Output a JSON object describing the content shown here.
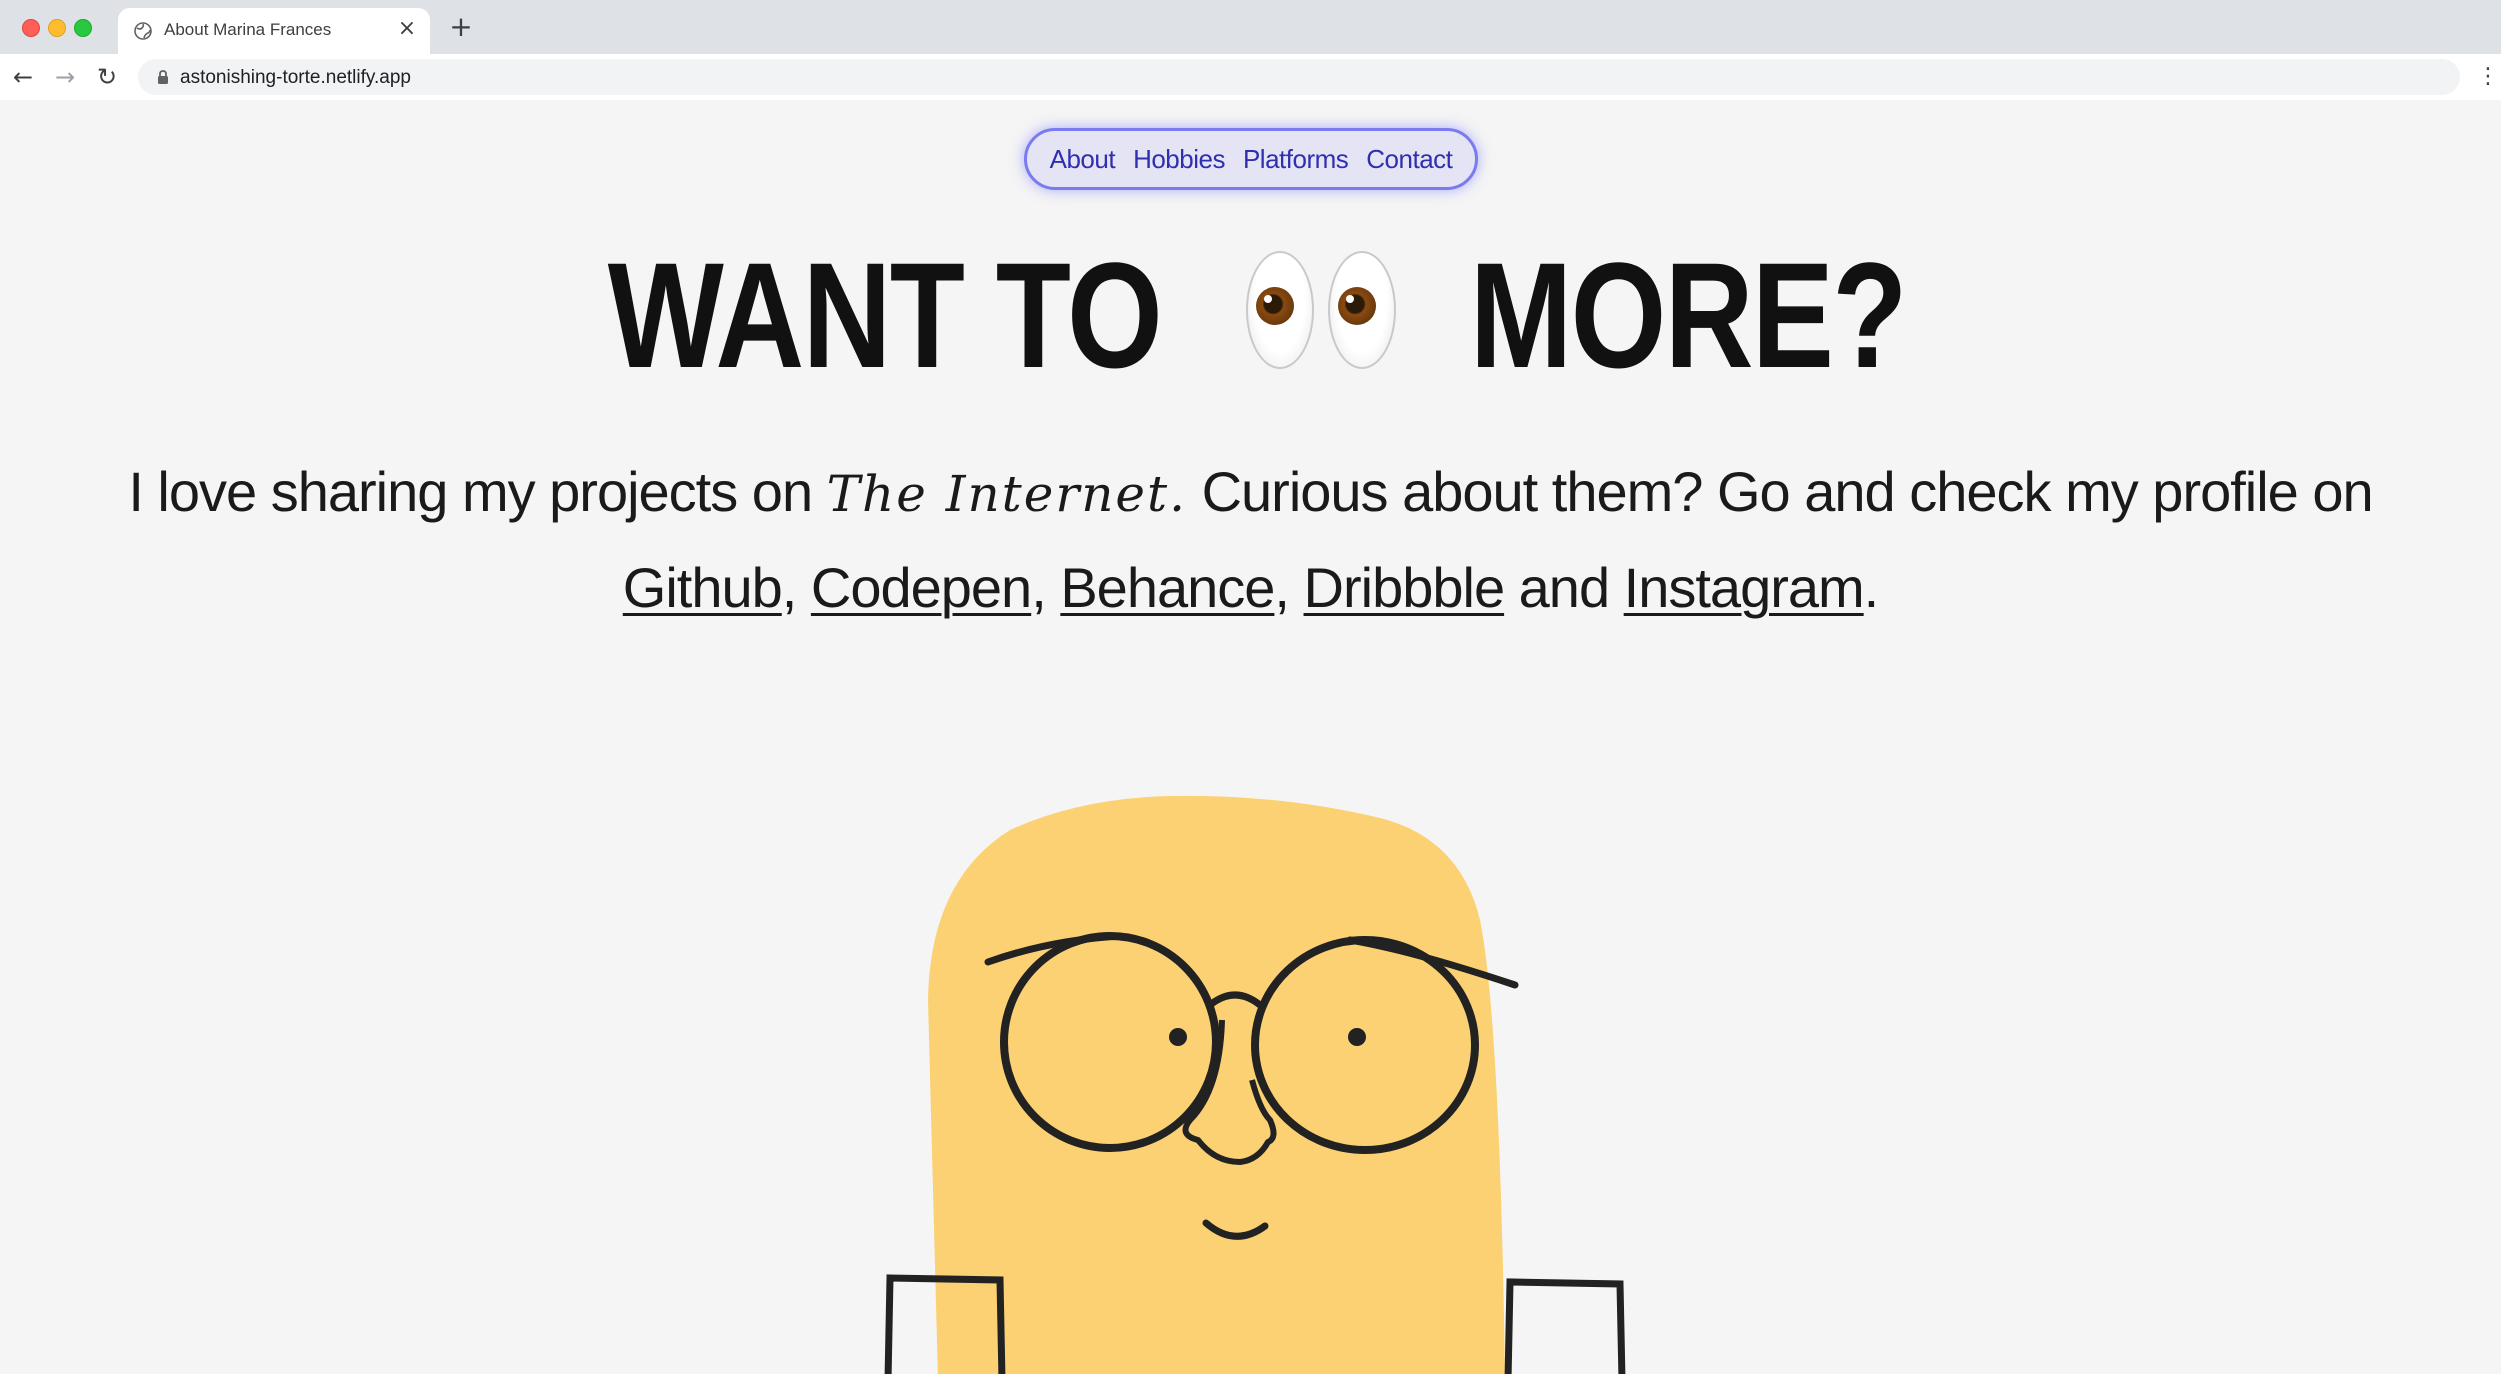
{
  "browser": {
    "tab_title": "About Marina Frances",
    "url": "astonishing-torte.netlify.app",
    "new_tab_symbol": "+",
    "close_symbol": "×"
  },
  "nav": {
    "items": [
      "About",
      "Hobbies",
      "Platforms",
      "Contact"
    ]
  },
  "hero": {
    "headline_start": "WANT TO",
    "headline_emoji": "eyes-emoji",
    "headline_end": "MORE?"
  },
  "intro": {
    "part1": "I love sharing my projects on",
    "fancy": "The Internet.",
    "part2": "Curious about them? Go and check my profile on",
    "links": [
      "Github",
      "Codepen",
      "Behance",
      "Dribbble",
      "Instagram"
    ],
    "and": "and",
    "end": "."
  },
  "colors": {
    "page_bg": "#f5f5f5",
    "nav_bg": "#e4e4f5",
    "nav_border": "#7b7bf0",
    "nav_text": "#2f2fb0",
    "character_skin": "#fbd173",
    "line_color": "#222222"
  }
}
